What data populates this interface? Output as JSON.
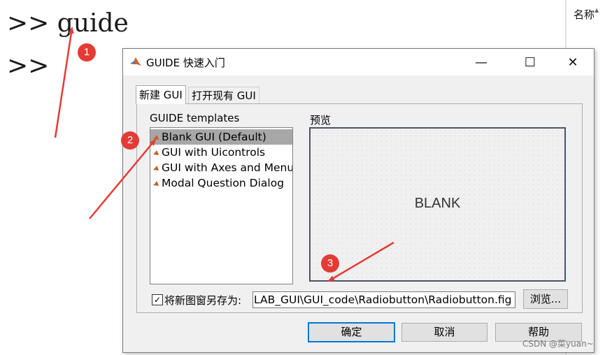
{
  "command_window": {
    "prompt1": ">> guide",
    "prompt2": ">>"
  },
  "side_panel": {
    "header": "名称"
  },
  "dialog": {
    "title": "GUIDE 快速入门",
    "window_controls": {
      "minimize": "—",
      "maximize": "☐",
      "close": "✕"
    },
    "tabs": [
      {
        "label": "新建 GUI",
        "active": true
      },
      {
        "label": "打开现有 GUI",
        "active": false
      }
    ],
    "templates_label": "GUIDE templates",
    "templates": [
      {
        "label": "Blank GUI (Default)",
        "selected": true
      },
      {
        "label": "GUI with Uicontrols",
        "selected": false
      },
      {
        "label": "GUI with Axes and Menu",
        "selected": false
      },
      {
        "label": "Modal Question Dialog",
        "selected": false
      }
    ],
    "preview_label": "预览",
    "preview_text": "BLANK",
    "save_checkbox": {
      "checked": true,
      "label": "将新图窗另存为:",
      "mark": "✓"
    },
    "save_path": "LAB_GUI\\GUI_code\\Radiobutton\\Radiobutton.fig",
    "browse_button": "浏览...",
    "buttons": {
      "ok": "确定",
      "cancel": "取消",
      "help": "帮助"
    }
  },
  "annotations": [
    "1",
    "2",
    "3"
  ],
  "annotation_color": "#e43b36",
  "watermark": "CSDN @菜yuan~"
}
